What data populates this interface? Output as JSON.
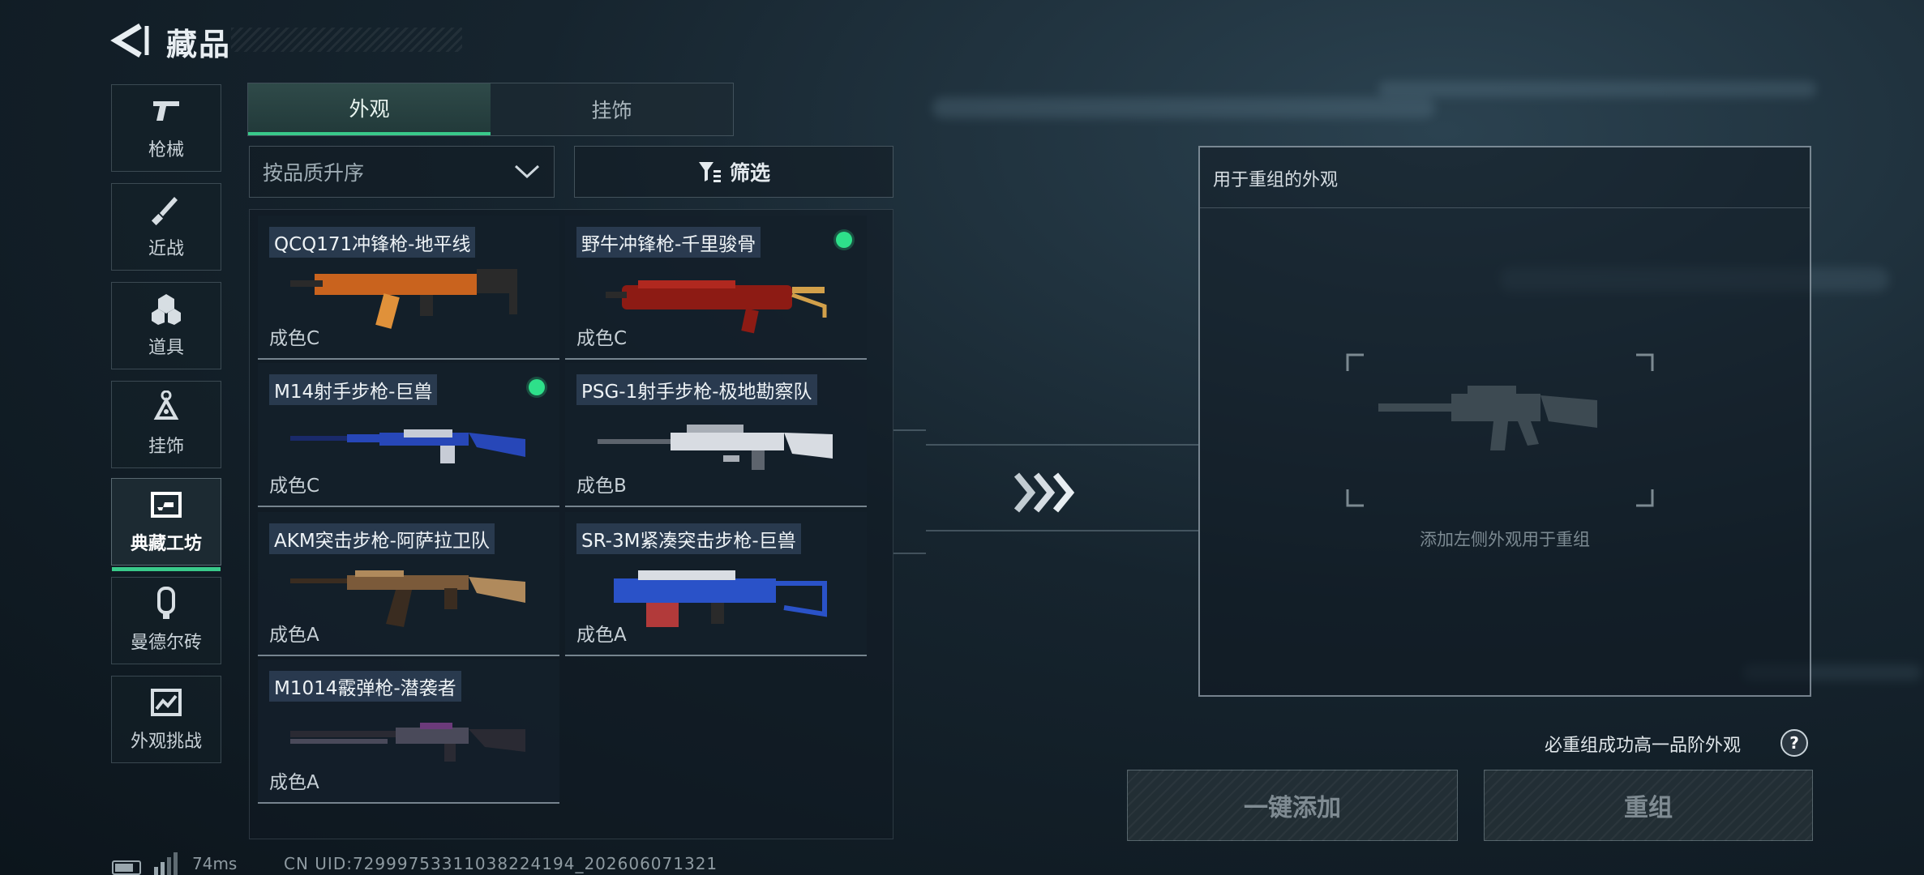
{
  "header": {
    "title": "藏品",
    "back_icon": "back-arrow-icon"
  },
  "sidebar": {
    "items": [
      {
        "label": "枪械",
        "icon": "pistol-icon",
        "active": false
      },
      {
        "label": "近战",
        "icon": "knife-icon",
        "active": false
      },
      {
        "label": "道具",
        "icon": "grenade-icon",
        "active": false
      },
      {
        "label": "挂饰",
        "icon": "charm-icon",
        "active": false
      },
      {
        "label": "典藏工坊",
        "icon": "workshop-icon",
        "active": true
      },
      {
        "label": "曼德尔砖",
        "icon": "brick-icon",
        "active": false
      },
      {
        "label": "外观挑战",
        "icon": "challenge-icon",
        "active": false
      }
    ]
  },
  "tabs": [
    {
      "label": "外观",
      "active": true
    },
    {
      "label": "挂饰",
      "active": false
    }
  ],
  "sort": {
    "label": "按品质升序"
  },
  "filter": {
    "label": "筛选"
  },
  "skins": [
    {
      "name": "QCQ171冲锋枪-地平线",
      "quality": "成色C",
      "equipped": false,
      "palette": [
        "#c9631e",
        "#2a2a2a",
        "#e0913a"
      ]
    },
    {
      "name": "野牛冲锋枪-千里骏骨",
      "quality": "成色C",
      "equipped": true,
      "palette": [
        "#8d1b14",
        "#b0281f",
        "#d2a04a"
      ]
    },
    {
      "name": "M14射手步枪-巨兽",
      "quality": "成色C",
      "equipped": true,
      "palette": [
        "#2747b8",
        "#c7ccd6",
        "#1a2a6a"
      ]
    },
    {
      "name": "PSG-1射手步枪-极地勘察队",
      "quality": "成色B",
      "equipped": false,
      "palette": [
        "#d8dce2",
        "#5d646d",
        "#a8aeb6"
      ]
    },
    {
      "name": "AKM突击步枪-阿萨拉卫队",
      "quality": "成色A",
      "equipped": false,
      "palette": [
        "#7b5a3a",
        "#3a2c20",
        "#b08a5c"
      ]
    },
    {
      "name": "SR-3M紧凑突击步枪-巨兽",
      "quality": "成色A",
      "equipped": false,
      "palette": [
        "#2a52c8",
        "#d9dde3",
        "#b23a3a"
      ]
    },
    {
      "name": "M1014霰弹枪-潜袭者",
      "quality": "成色A",
      "equipped": false,
      "palette": [
        "#4a4a5a",
        "#6b3a7a",
        "#2a2a33"
      ]
    }
  ],
  "reconstruct": {
    "panel_title": "用于重组的外观",
    "placeholder": "添加左侧外观用于重组",
    "hint": "必重组成功高一品阶外观",
    "help_label": "?",
    "add_all_label": "一键添加",
    "reconstruct_label": "重组"
  },
  "footer": {
    "ping": "74ms",
    "uid": "CN UID:7299975331103822419​4_202606071321"
  },
  "colors": {
    "accent": "#39c98a",
    "equipped_dot": "#2ee08a"
  }
}
